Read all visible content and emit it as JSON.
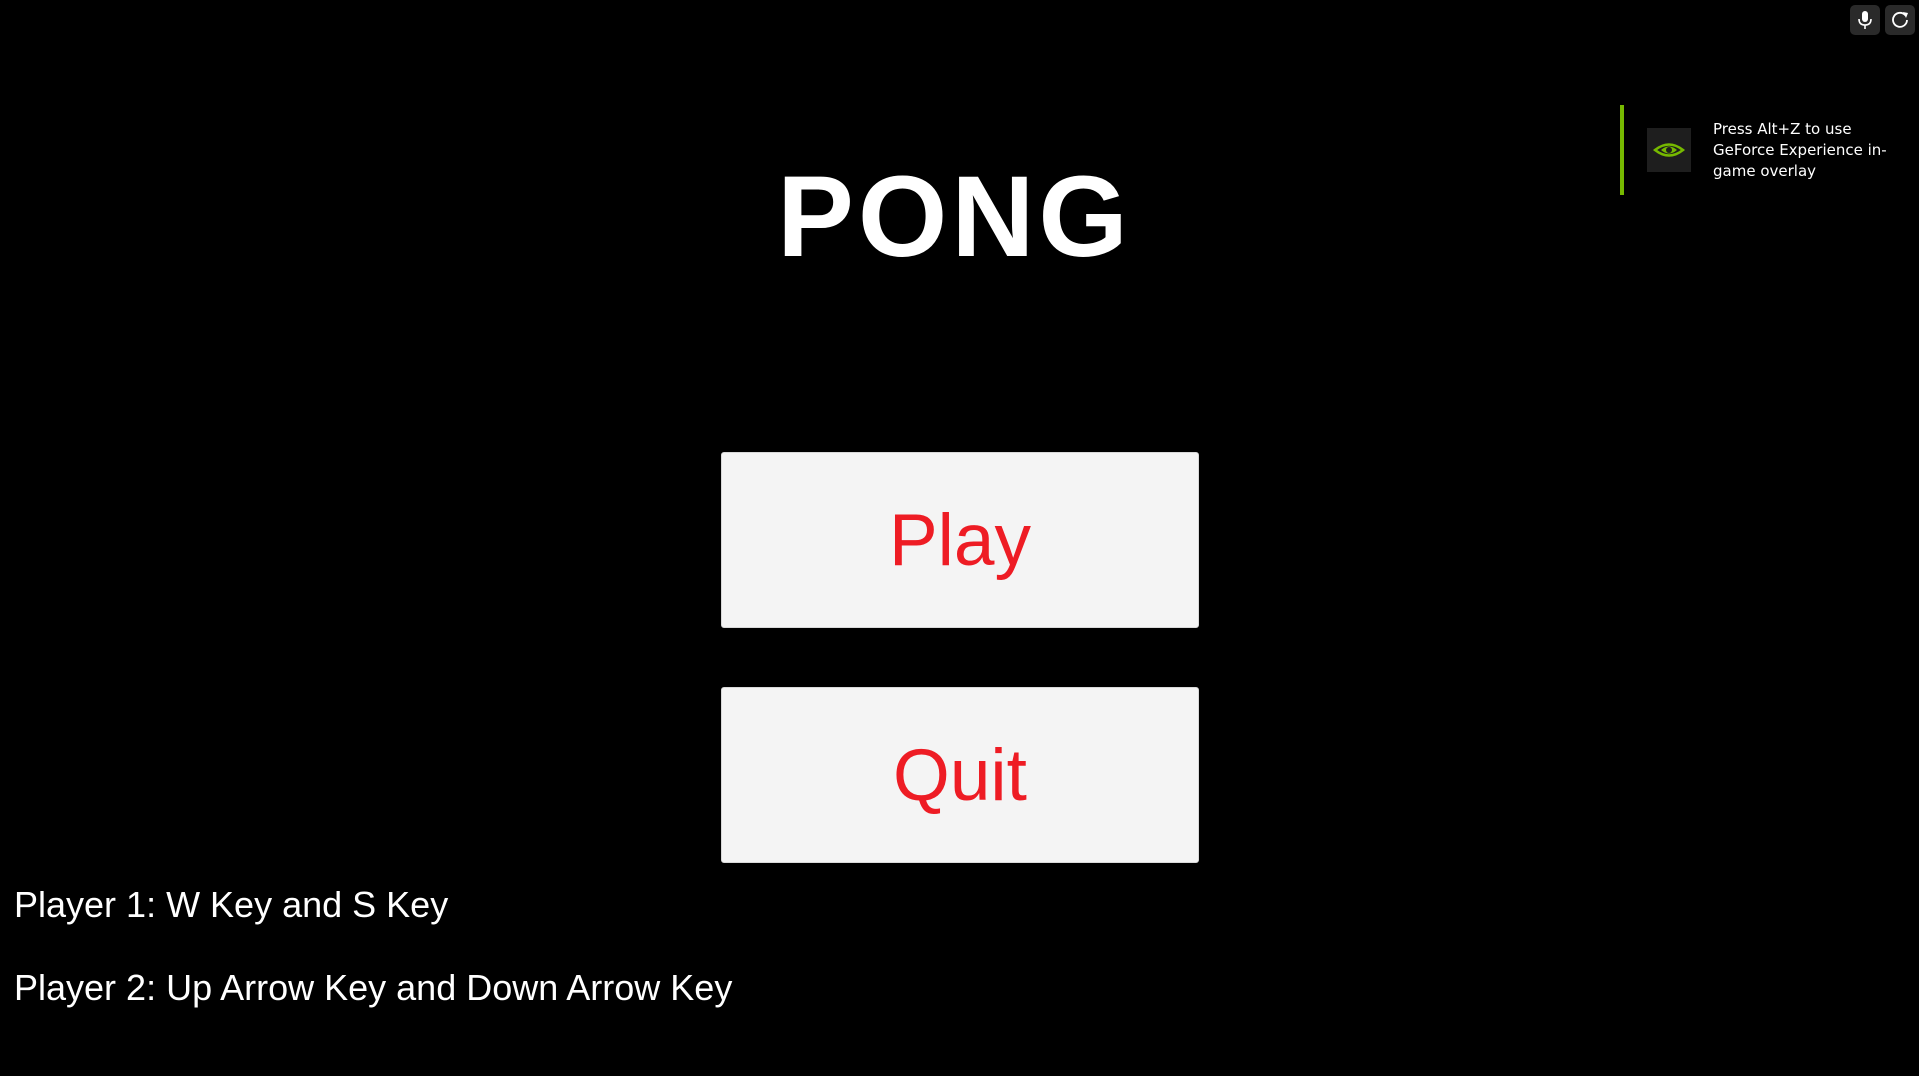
{
  "game": {
    "title": "PONG",
    "buttons": {
      "play_label": "Play",
      "quit_label": "Quit"
    },
    "controls": {
      "player1": "Player 1: W Key and S Key",
      "player2": "Player 2: Up Arrow Key and Down Arrow Key"
    }
  },
  "overlay": {
    "widgets": [
      "microphone-icon",
      "refresh-icon"
    ],
    "notification": {
      "icon": "nvidia-logo-icon",
      "text": "Press Alt+Z to use GeForce Experience in-game overlay"
    }
  },
  "colors": {
    "background": "#000000",
    "title": "#ffffff",
    "button_bg": "#f4f4f4",
    "button_text": "#ee1c24",
    "accent_green": "#76b900"
  }
}
